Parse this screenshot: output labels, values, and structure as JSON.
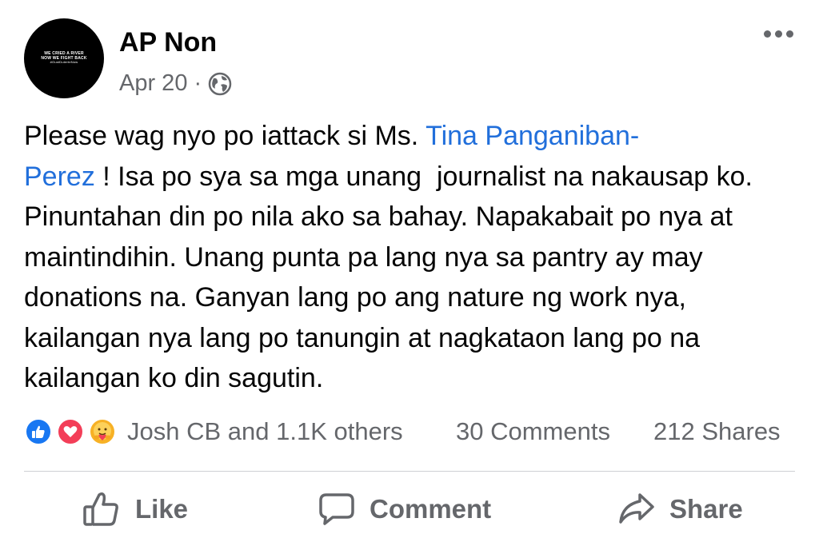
{
  "post": {
    "author": "AP Non",
    "avatar_lines": [
      "WE CRIED A RIVER",
      "NOW WE FIGHT BACK",
      "#OustDuterteNow"
    ],
    "date": "Apr 20",
    "separator": "·",
    "privacy_icon": "globe-icon",
    "more_icon": "more-options-icon",
    "text_before": "Please wag nyo po iattack si Ms. ",
    "mention": "Tina Panganiban-\nPerez",
    "text_after": " ! Isa po sya sa mga unang  journalist na nakausap ko. Pinuntahan din po nila ako sa bahay. Napakabait po nya at maintindihin. Unang punta pa lang nya sa pantry ay may donations na. Ganyan lang po ang nature ng work nya, kailangan nya lang po tanungin at nagkataon lang po na kailangan ko din sagutin."
  },
  "reactions": {
    "icons": [
      "like-reaction-icon",
      "love-reaction-icon",
      "care-reaction-icon"
    ],
    "summary": "Josh CB and 1.1K others",
    "comments": "30 Comments",
    "shares": "212 Shares"
  },
  "actions": {
    "like": "Like",
    "comment": "Comment",
    "share": "Share"
  },
  "colors": {
    "mention": "#216fdb",
    "secondary_text": "#65676b",
    "like": "#1877f2",
    "love": "#f33e58",
    "care": "#f7b125"
  }
}
